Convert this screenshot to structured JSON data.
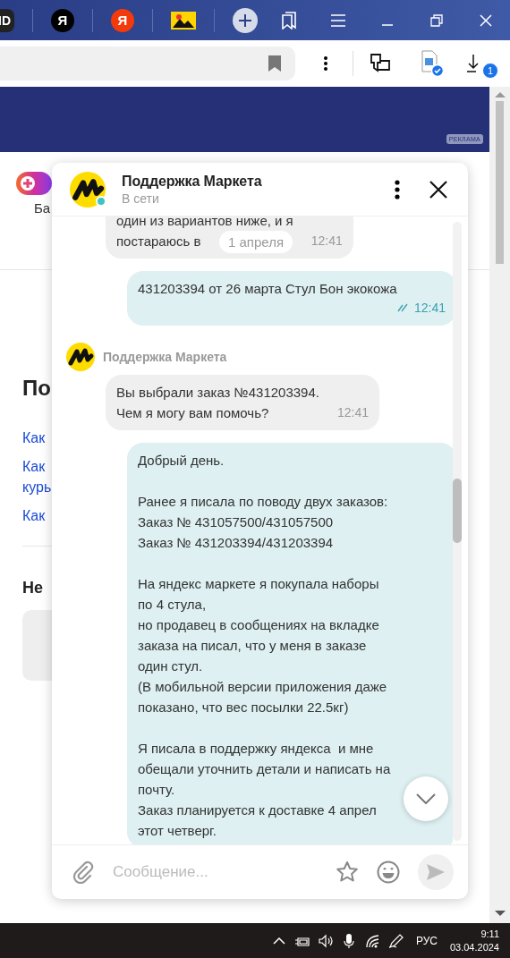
{
  "browser": {
    "tabs": [
      {
        "kind": "id",
        "label": "ID"
      },
      {
        "kind": "ya-black",
        "label": "Я"
      },
      {
        "kind": "ya-red",
        "label": "Я"
      },
      {
        "kind": "image"
      }
    ],
    "download_badge": "1"
  },
  "ad_banner": {
    "badge": "РЕКЛАМА"
  },
  "page": {
    "balance_label": "Ба",
    "heading": "По",
    "links": [
      "Как",
      "Как\nкурь",
      "Как"
    ],
    "subheading": "Не"
  },
  "chat": {
    "title": "Поддержка Маркета",
    "status": "В сети",
    "online": true,
    "date_pill": "1 апреля",
    "messages": [
      {
        "kind": "incoming",
        "paragraphs": [
          "один из вариантов ниже, и я",
          "постараюсь в"
        ],
        "time": "12:41"
      },
      {
        "kind": "outgoing",
        "paragraphs": [
          "431203394 от 26 марта Стул Бон экокожа"
        ],
        "time": "12:41",
        "read": true
      },
      {
        "kind": "sender",
        "name": "Поддержка Маркета"
      },
      {
        "kind": "incoming",
        "paragraphs": [
          "Вы выбрали заказ №431203394.\nЧем я могу вам помочь?"
        ],
        "time": "12:41"
      },
      {
        "kind": "outgoing",
        "paragraphs": [
          "Добрый день.",
          "Ранее я писала по поводу двух заказов:\nЗаказ № 431057500/431057500\nЗаказ № 431203394/431203394",
          "На яндекс маркете я покупала наборы\nпо 4 стула,\nно продавец в сообщениях на вкладке\nзаказа на писал, что у меня в заказе\nодин стул.\n(В мобильной версии приложения даже\nпоказано, что вес посылки 22.5кг)",
          "Я писала в поддержку яндекса  и мне\nобещали уточнить детали и написать на\nпочту.\nЗаказ планируется к доставке 4 апрел\nэтот четверг."
        ]
      }
    ],
    "input": {
      "placeholder": "Сообщение..."
    }
  },
  "taskbar": {
    "language": "РУС",
    "time": "9:11",
    "date": "03.04.2024"
  }
}
